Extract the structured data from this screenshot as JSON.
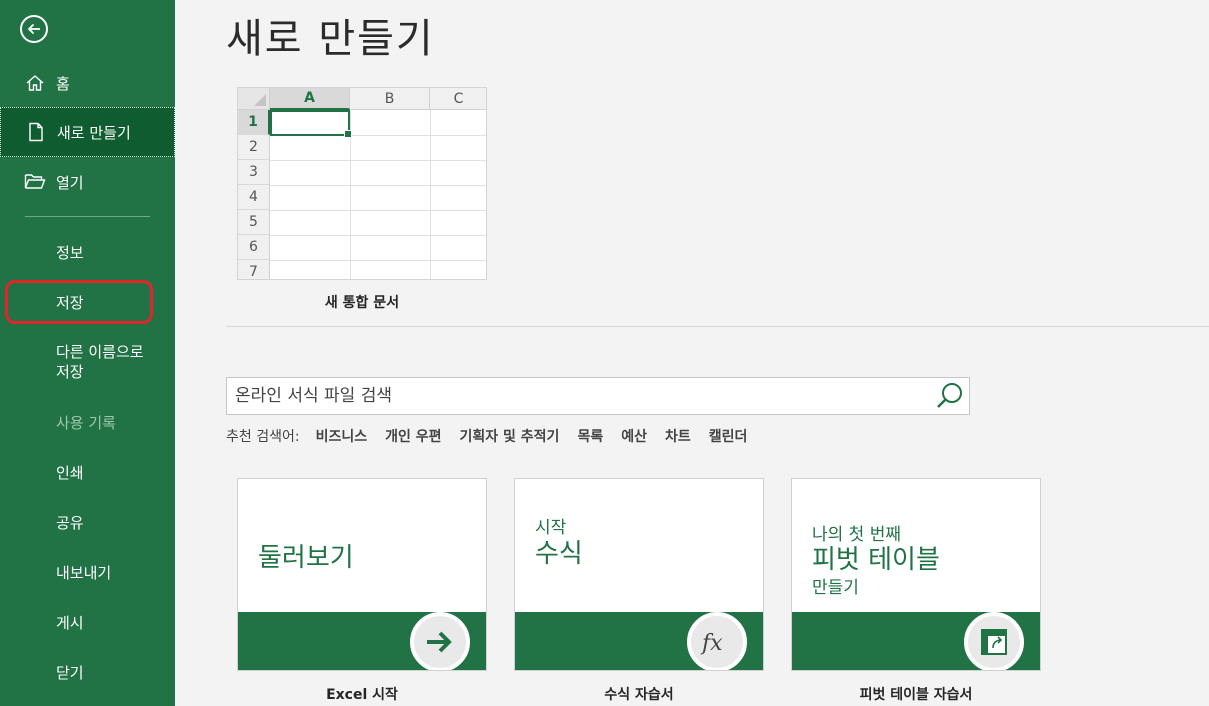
{
  "nav": {
    "home": "홈",
    "new": "새로 만들기",
    "open": "열기",
    "info": "정보",
    "save": "저장",
    "save_as_line1": "다른 이름으로",
    "save_as_line2": "저장",
    "history": "사용 기록",
    "print": "인쇄",
    "share": "공유",
    "export": "내보내기",
    "publish": "게시",
    "close": "닫기"
  },
  "main": {
    "title": "새로 만들기",
    "blank": {
      "caption": "새 통합 문서",
      "columns": [
        "A",
        "B",
        "C"
      ],
      "rows": [
        "1",
        "2",
        "3",
        "4",
        "5",
        "6",
        "7"
      ]
    },
    "search": {
      "placeholder": "온라인 서식 파일 검색"
    },
    "suggested": {
      "label": "추천 검색어:",
      "keywords": [
        "비즈니스",
        "개인 우편",
        "기획자 및 추적기",
        "목록",
        "예산",
        "차트",
        "캘린더"
      ]
    },
    "templates": [
      {
        "main": "둘러보기",
        "caption": "Excel 시작"
      },
      {
        "small": "시작",
        "main": "수식",
        "caption": "수식 자습서"
      },
      {
        "small": "나의 첫 번째",
        "main": "피벗 테이블",
        "small2": "만들기",
        "caption": "피벗 테이블 자습서"
      }
    ]
  },
  "colors": {
    "brand": "#217346",
    "highlight": "#e0262b"
  }
}
